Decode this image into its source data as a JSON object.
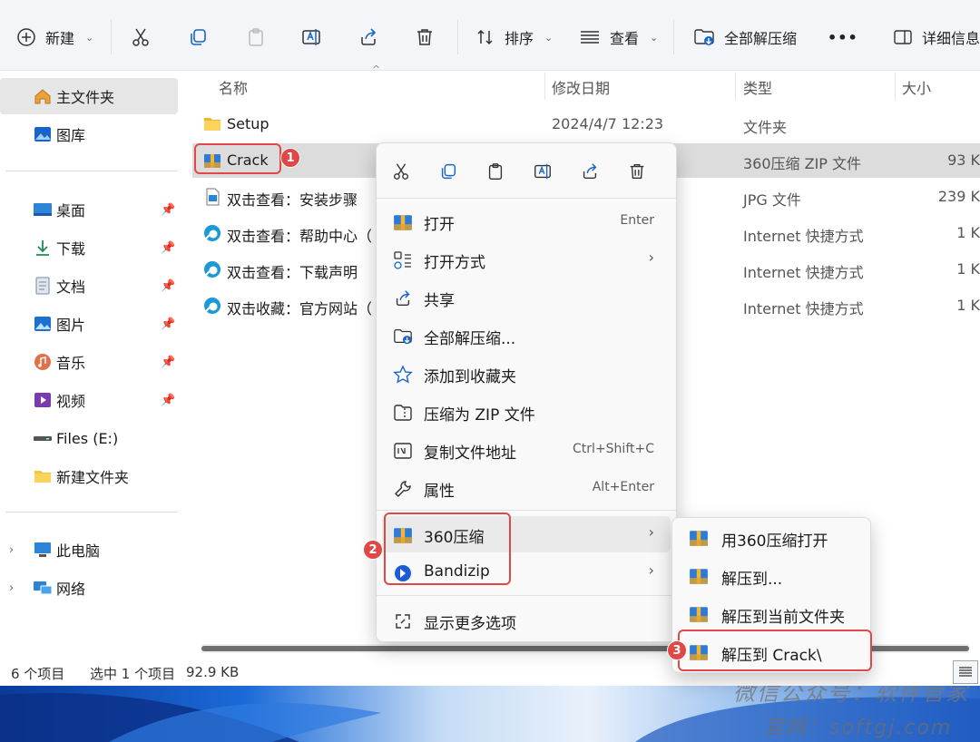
{
  "toolbar": {
    "new_label": "新建",
    "sort_label": "排序",
    "view_label": "查看",
    "extract_all_label": "全部解压缩",
    "more_label": "•••",
    "details_label": "详细信息"
  },
  "sidebar": {
    "pinned_top": [
      {
        "label": "主文件夹",
        "icon": "home-icon"
      },
      {
        "label": "图库",
        "icon": "gallery-icon"
      }
    ],
    "quick": [
      {
        "label": "桌面",
        "icon": "desktop-icon"
      },
      {
        "label": "下载",
        "icon": "download-icon"
      },
      {
        "label": "文档",
        "icon": "document-icon"
      },
      {
        "label": "图片",
        "icon": "pictures-icon"
      },
      {
        "label": "音乐",
        "icon": "music-icon"
      },
      {
        "label": "视频",
        "icon": "video-icon"
      },
      {
        "label": "Files (E:)",
        "icon": "drive-icon"
      },
      {
        "label": "新建文件夹",
        "icon": "folder-icon"
      }
    ],
    "tree": [
      {
        "label": "此电脑",
        "icon": "pc-icon"
      },
      {
        "label": "网络",
        "icon": "network-icon"
      }
    ]
  },
  "columns": {
    "name": "名称",
    "date": "修改日期",
    "type": "类型",
    "size": "大小"
  },
  "files": [
    {
      "name": "Setup",
      "date": "2024/4/7 12:23",
      "type": "文件夹",
      "size": ""
    },
    {
      "name": "Crack",
      "date": "",
      "type": "360压缩 ZIP 文件",
      "size": "93 K"
    },
    {
      "name": "双击查看：安装步骤",
      "date": "",
      "type": "JPG 文件",
      "size": "239 K"
    },
    {
      "name": "双击查看：帮助中心（",
      "date": "",
      "type": "Internet 快捷方式",
      "size": "1 K"
    },
    {
      "name": "双击查看：下载声明",
      "date": "",
      "type": "Internet 快捷方式",
      "size": "1 K"
    },
    {
      "name": "双击收藏：官方网站（",
      "date": "",
      "type": "Internet 快捷方式",
      "size": "1 K"
    }
  ],
  "context_menu": {
    "items": [
      {
        "label": "打开",
        "shortcut": "Enter"
      },
      {
        "label": "打开方式",
        "shortcut": ""
      },
      {
        "label": "共享",
        "shortcut": ""
      },
      {
        "label": "全部解压缩...",
        "shortcut": ""
      },
      {
        "label": "添加到收藏夹",
        "shortcut": ""
      },
      {
        "label": "压缩为 ZIP 文件",
        "shortcut": ""
      },
      {
        "label": "复制文件地址",
        "shortcut": "Ctrl+Shift+C"
      },
      {
        "label": "属性",
        "shortcut": "Alt+Enter"
      }
    ],
    "ext_items": [
      {
        "label": "360压缩"
      },
      {
        "label": "Bandizip"
      }
    ],
    "more_options": "显示更多选项"
  },
  "submenu": {
    "items": [
      {
        "label": "用360压缩打开"
      },
      {
        "label": "解压到..."
      },
      {
        "label": "解压到当前文件夹"
      },
      {
        "label": "解压到 Crack\\"
      }
    ]
  },
  "badges": {
    "one": "1",
    "two": "2",
    "three": "3"
  },
  "status": {
    "count": "6 个项目",
    "selected": "选中 1 个项目",
    "size": "92.9 KB"
  },
  "watermark": {
    "line1": "微信公众号：软件管家",
    "line2": "官网：softgj.com"
  },
  "colors": {
    "accent": "#0067c0",
    "highlight": "#e04848",
    "selection": "#dcdcdc"
  }
}
